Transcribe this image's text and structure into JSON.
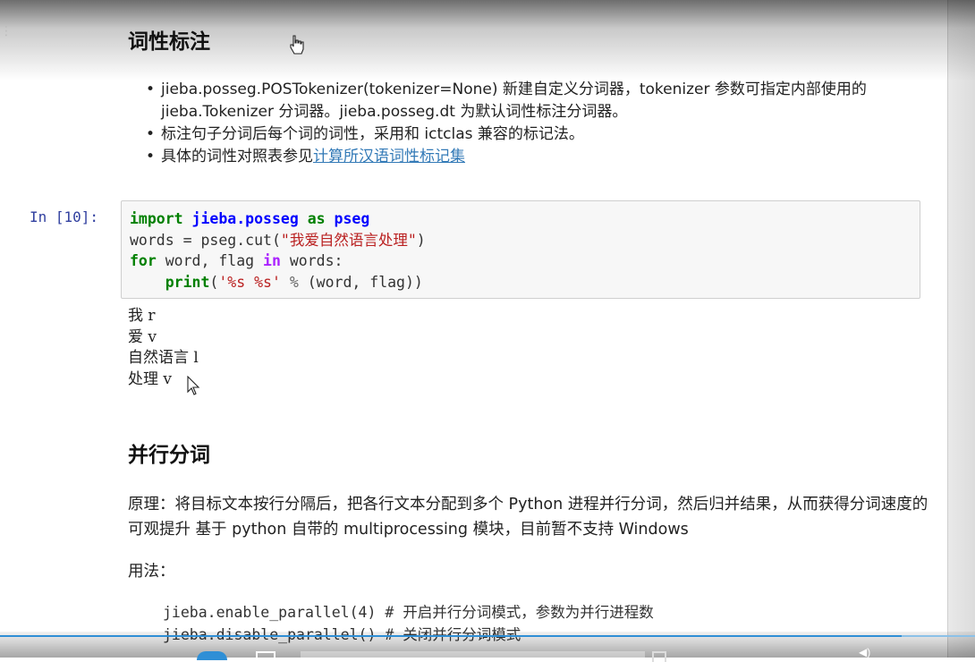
{
  "sections": {
    "pos_tagging": {
      "heading": "词性标注",
      "bullets": [
        {
          "text": "jieba.posseg.POSTokenizer(tokenizer=None) 新建自定义分词器，tokenizer 参数可指定内部使用的 jieba.Tokenizer 分词器。jieba.posseg.dt 为默认词性标注分词器。"
        },
        {
          "text": "标注句子分词后每个词的词性，采用和 ictclas 兼容的标记法。"
        },
        {
          "text": "具体的词性对照表参见",
          "link": "计算所汉语词性标记集"
        }
      ]
    },
    "parallel": {
      "heading": "并行分词",
      "principle": "原理：将目标文本按行分隔后，把各行文本分配到多个 Python 进程并行分词，然后归并结果，从而获得分词速度的可观提升 基于 python 自带的 multiprocessing 模块，目前暂不支持 Windows",
      "usage_label": "用法：",
      "usage_lines": [
        {
          "code": "jieba.enable_parallel(4)",
          "comment": "# 开启并行分词模式，参数为并行进程数"
        },
        {
          "code": "jieba.disable_parallel()",
          "comment": "# 关闭并行分词模式"
        }
      ]
    }
  },
  "cell": {
    "prompt": "In [10]:",
    "code": {
      "l1": {
        "kw_import": "import",
        "module": "jieba.posseg",
        "kw_as": "as",
        "alias": "pseg"
      },
      "l2": {
        "pre": "words = pseg.cut(",
        "str": "\"我爱自然语言处理\"",
        "post": ")"
      },
      "l3": {
        "kw_for": "for",
        "mid": " word, flag ",
        "kw_in": "in",
        "post": " words:"
      },
      "l4": {
        "indent": "    ",
        "kw_print": "print",
        "open": "(",
        "str": "'%s %s'",
        "op": " % ",
        "post": "(word, flag))"
      }
    },
    "output": [
      "我 r",
      "爱 v",
      "自然语言 l",
      "处理 v"
    ]
  },
  "video": {
    "progress": 0.925,
    "accent": "#2f8fd6"
  },
  "colors": {
    "link": "#337ab7",
    "prompt": "#303f9f",
    "keyword": "#008000",
    "string": "#ba2121"
  },
  "icons": [
    "hand-pointer-icon",
    "arrow-cursor-icon"
  ]
}
